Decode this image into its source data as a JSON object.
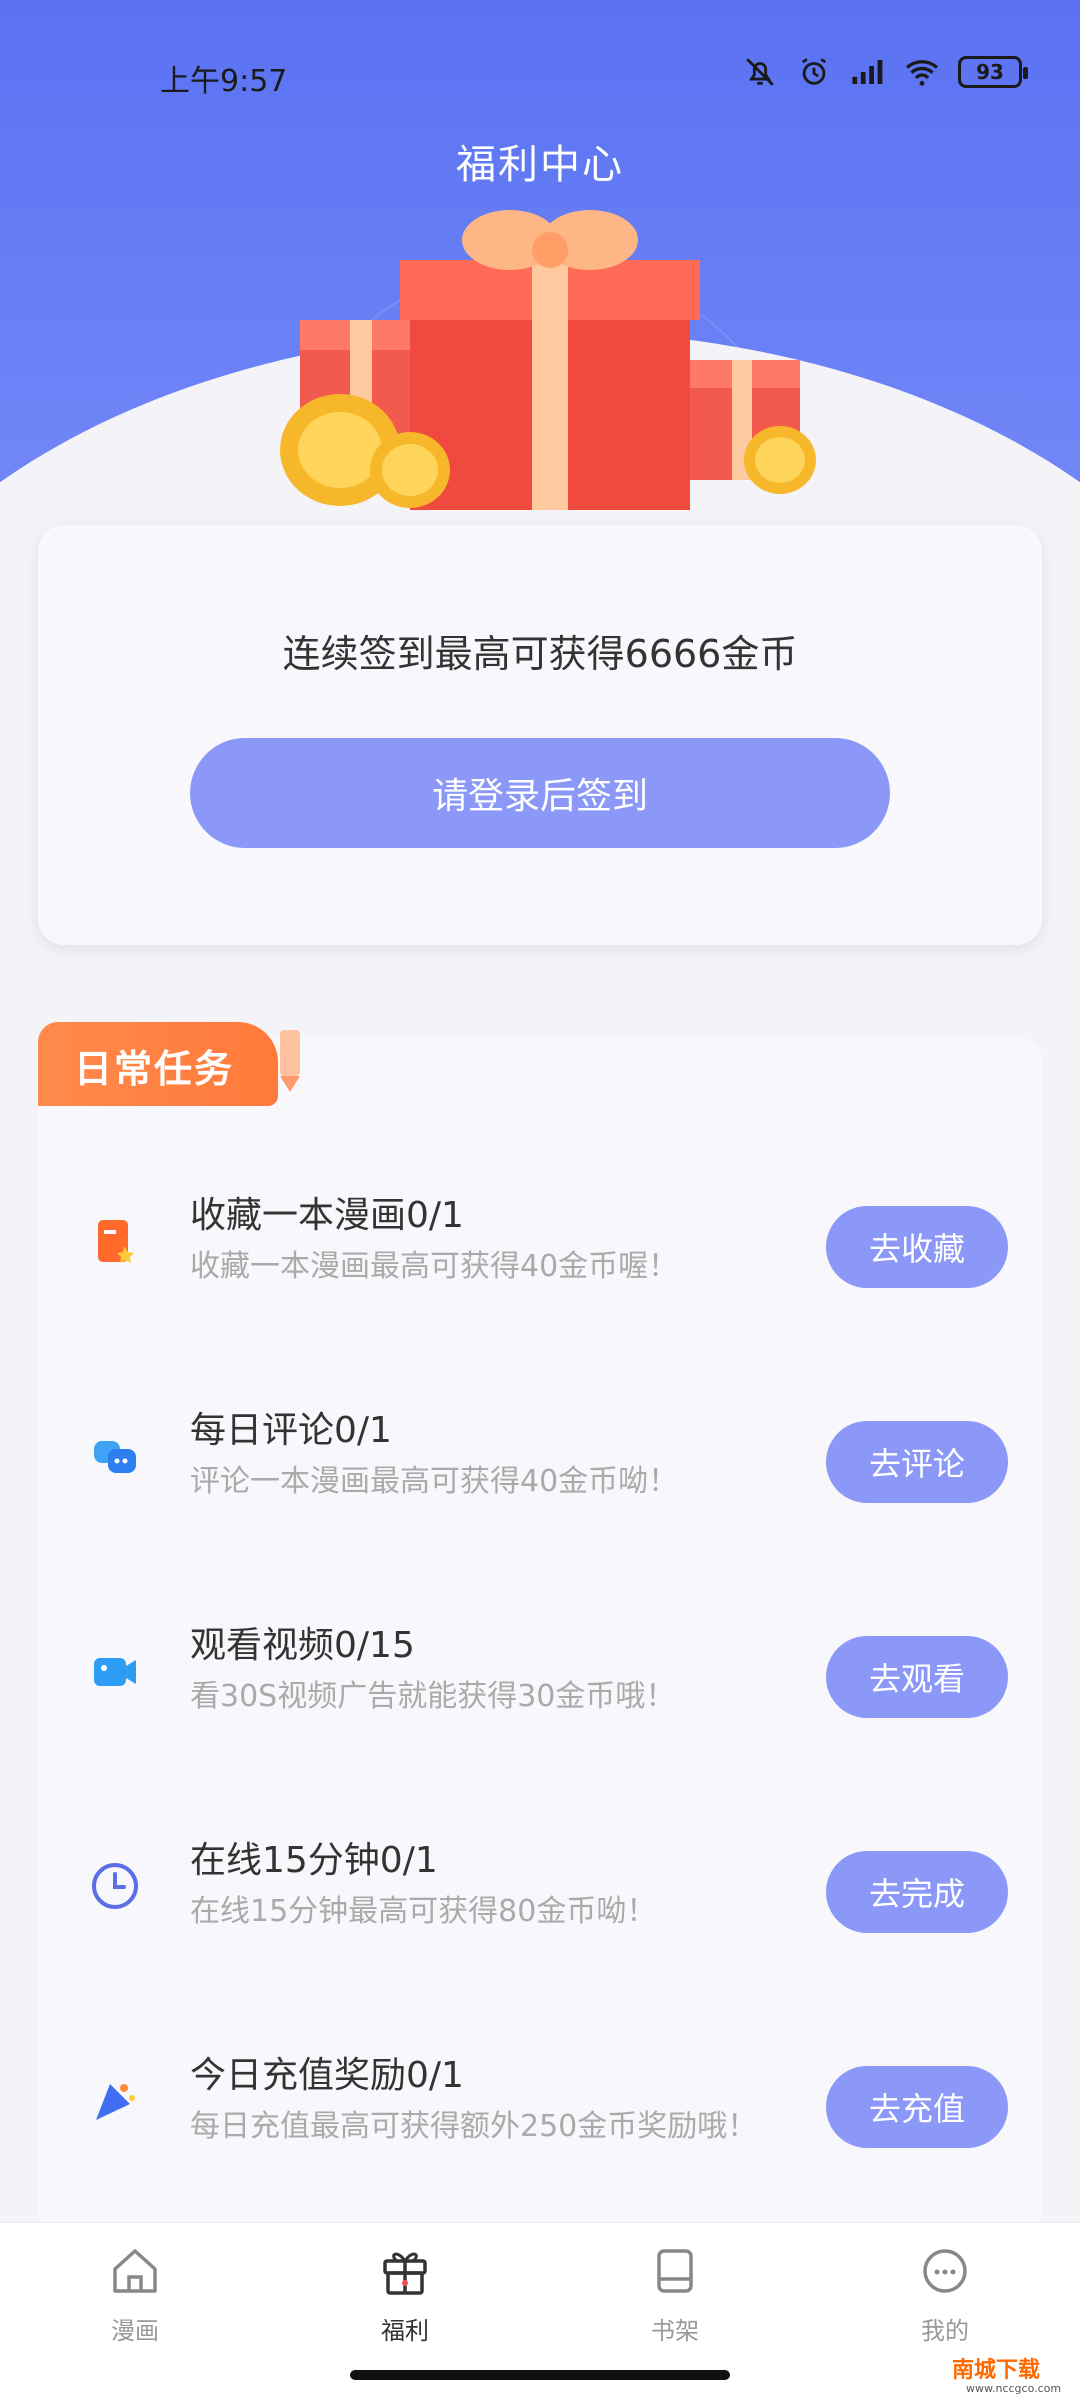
{
  "status": {
    "time": "上午9:57",
    "battery": "93"
  },
  "header": {
    "title": "福利中心"
  },
  "sign_in": {
    "promo_text": "连续签到最高可获得6666金币",
    "button_label": "请登录后签到"
  },
  "daily_tasks": {
    "section_title": "日常任务",
    "items": [
      {
        "title": "收藏一本漫画0/1",
        "desc": "收藏一本漫画最高可获得40金币喔！",
        "button": "去收藏",
        "icon": "bookmark-icon"
      },
      {
        "title": "每日评论0/1",
        "desc": "评论一本漫画最高可获得40金币呦！",
        "button": "去评论",
        "icon": "comment-icon"
      },
      {
        "title": "观看视频0/15",
        "desc": "看30S视频广告就能获得30金币哦！",
        "button": "去观看",
        "icon": "video-icon"
      },
      {
        "title": "在线15分钟0/1",
        "desc": "在线15分钟最高可获得80金币呦！",
        "button": "去完成",
        "icon": "clock-icon"
      },
      {
        "title": "今日充值奖励0/1",
        "desc": "每日充值最高可获得额外250金币奖励哦！",
        "button": "去充值",
        "icon": "recharge-icon"
      }
    ]
  },
  "tabbar": {
    "items": [
      {
        "label": "漫画",
        "icon": "home-icon"
      },
      {
        "label": "福利",
        "icon": "gift-icon",
        "active": true
      },
      {
        "label": "书架",
        "icon": "bookshelf-icon"
      },
      {
        "label": "我的",
        "icon": "profile-icon"
      }
    ]
  },
  "watermark": {
    "text": "南城下载",
    "sub": "www.nccgco.com"
  },
  "colors": {
    "accent": "#8b98f7",
    "hero": "#5a72f2",
    "task_header": "#ff7a3a"
  }
}
